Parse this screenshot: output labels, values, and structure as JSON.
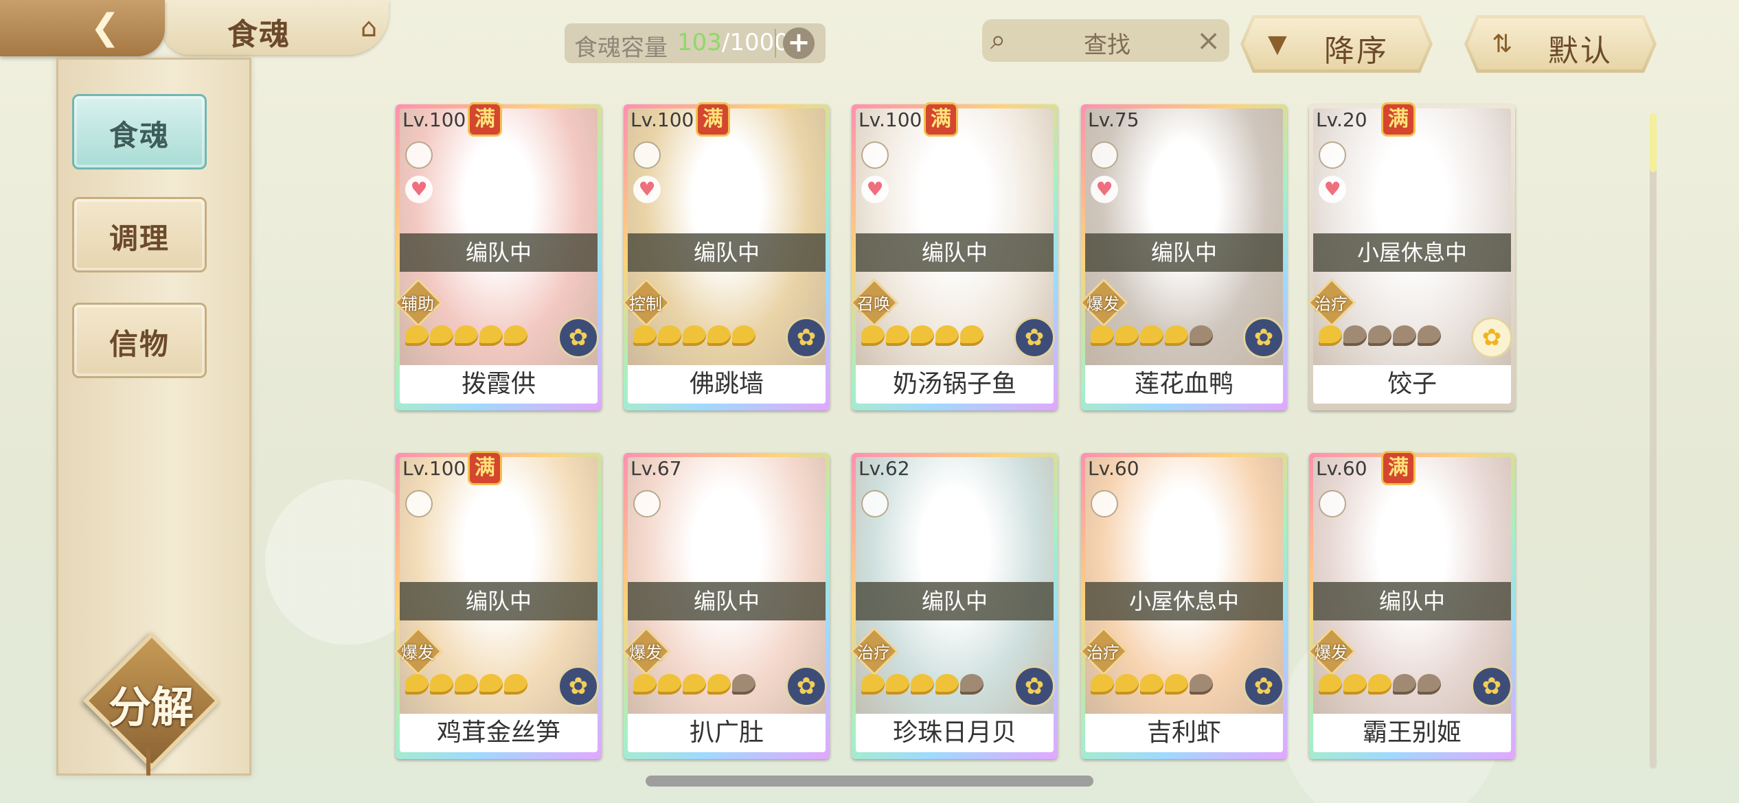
{
  "header": {
    "title": "食魂",
    "capacity_label": "食魂容量",
    "capacity_current": "103",
    "capacity_total": "/1000",
    "search_placeholder": "查找",
    "sort_order_label": "降序",
    "sort_mode_label": "默认"
  },
  "sidebar": {
    "items": [
      {
        "label": "食魂",
        "active": true
      },
      {
        "label": "调理",
        "active": false
      },
      {
        "label": "信物",
        "active": false
      }
    ],
    "decompose_label": "分解"
  },
  "full_badge": "满",
  "cards": [
    {
      "level": "Lv.100",
      "full": true,
      "heart": true,
      "status": "编队中",
      "role": "辅助",
      "stars": 5,
      "element": "blue",
      "name": "拨霞供",
      "hue": "#f3c9c2"
    },
    {
      "level": "Lv.100",
      "full": true,
      "heart": true,
      "status": "编队中",
      "role": "控制",
      "stars": 5,
      "element": "blue",
      "name": "佛跳墙",
      "hue": "#e9d3a6"
    },
    {
      "level": "Lv.100",
      "full": true,
      "heart": true,
      "status": "编队中",
      "role": "召唤",
      "stars": 5,
      "element": "blue",
      "name": "奶汤锅子鱼",
      "hue": "#efe7dc"
    },
    {
      "level": "Lv.75",
      "full": false,
      "heart": true,
      "status": "编队中",
      "role": "爆发",
      "stars": 4,
      "element": "blue",
      "name": "莲花血鸭",
      "hue": "#cfc6bd"
    },
    {
      "level": "Lv.20",
      "full": true,
      "heart": true,
      "status": "小屋休息中",
      "role": "治疗",
      "stars": 1,
      "element": "gold",
      "name": "饺子",
      "hue": "#ece6e2"
    },
    {
      "level": "Lv.100",
      "full": true,
      "heart": false,
      "status": "编队中",
      "role": "爆发",
      "stars": 5,
      "element": "blue",
      "name": "鸡茸金丝笋",
      "hue": "#f3dcb8"
    },
    {
      "level": "Lv.67",
      "full": false,
      "heart": false,
      "status": "编队中",
      "role": "爆发",
      "stars": 4,
      "element": "blue",
      "name": "扒广肚",
      "hue": "#f4d8cc"
    },
    {
      "level": "Lv.62",
      "full": false,
      "heart": false,
      "status": "编队中",
      "role": "治疗",
      "stars": 4,
      "element": "blue",
      "name": "珍珠日月贝",
      "hue": "#cfe0de"
    },
    {
      "level": "Lv.60",
      "full": false,
      "heart": false,
      "status": "小屋休息中",
      "role": "治疗",
      "stars": 4,
      "element": "blue",
      "name": "吉利虾",
      "hue": "#f7d3b0"
    },
    {
      "level": "Lv.60",
      "full": true,
      "heart": false,
      "status": "编队中",
      "role": "爆发",
      "stars": 3,
      "element": "blue",
      "name": "霸王别姬",
      "hue": "#e8d8d4"
    }
  ]
}
